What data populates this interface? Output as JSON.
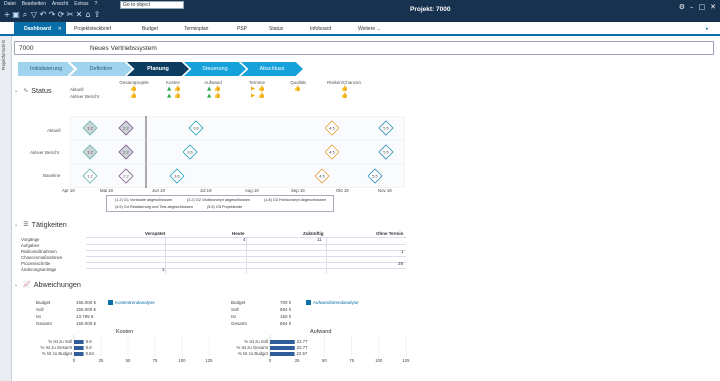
{
  "menu": [
    "Datei",
    "Bearbeiten",
    "Ansicht",
    "Extras",
    "?"
  ],
  "toolbar_icons": [
    "add-icon",
    "save-icon",
    "search-icon",
    "filter-icon",
    "undo-icon",
    "redo-icon",
    "refresh-icon",
    "tools-icon",
    "close-icon",
    "home-icon",
    "export-icon"
  ],
  "goto": "Go to object",
  "project_title": "Projekt: 7000",
  "tabs": {
    "dashboard": "Dashboard",
    "tab_close": "✕",
    "items": [
      "Projektsteckbrief",
      "Budget",
      "Terminplan",
      "PSP",
      "Status",
      "Infoboard",
      "Weitere ..."
    ]
  },
  "side_label": "Projektfortschritt",
  "project": {
    "number": "7000",
    "name": "Neues Vertriebssystem"
  },
  "phases": [
    "Initialisierung",
    "Definition",
    "Planung",
    "Steuerung",
    "Abschluss"
  ],
  "status": {
    "title": "Status",
    "headers": [
      "Gesamtprojekt",
      "Kosten",
      "Aufwand",
      "Termine",
      "Qualität",
      "Risiken/Chancen"
    ],
    "rows": [
      "Aktuell",
      "Aktiver Bericht"
    ]
  },
  "gantt": {
    "rows": [
      "Aktuell",
      "Aktiver Bericht",
      "Baseline"
    ],
    "months": [
      "Apr 19",
      "Mai 19",
      "Jun 19",
      "Jul 19",
      "Aug 19",
      "Sep 19",
      "Okt 19",
      "Nov 19"
    ],
    "milestones": {
      "aktuell": [
        "1.2",
        "2.2",
        "3.6",
        "4.5",
        "5.5"
      ],
      "bericht": [
        "1.2",
        "2.2",
        "3.6",
        "4.5",
        "5.5"
      ],
      "baseline": [
        "1.2",
        "2.2",
        "3.6",
        "4.5",
        "5.5"
      ]
    },
    "legend": [
      "(1.2) G1 Vorstudie abgeschlossen",
      "(2.2) G2 Grobkonzept abgeschlossen",
      "(1.8) G3 Feinkonzept abgeschlossen",
      "(4.5) G4 Realisierung und Test abgeschlossen",
      "(5.5) G5 Projektende"
    ]
  },
  "taetigkeiten": {
    "title": "Tätigkeiten",
    "columns": [
      "Verspätet",
      "Heute",
      "Zukünftig",
      "Ohne Termin"
    ],
    "rows": [
      "Vorgänge",
      "Aufgaben",
      "Risikomaßnahmen",
      "Chancenmaßnahmen",
      "Prozessschritte",
      "Änderungsanträge"
    ],
    "values": {
      "heute_vorgaenge": "4",
      "zukuenftig_vorgaenge": "11",
      "ohne_risiko": "1",
      "ohne_prozess": "29",
      "verspaetet_aenderung": "1"
    }
  },
  "abweichungen": {
    "title": "Abweichungen",
    "kosten": {
      "labels": [
        "Budget",
        "Soll",
        "Ist",
        "Gesamt"
      ],
      "values": [
        "156.000 €",
        "155.000 €",
        "13.795 €",
        "155.000 €"
      ],
      "link": "Kostentrendanalyse"
    },
    "aufwand": {
      "labels": [
        "Budget",
        "Soll",
        "Ist",
        "Gesamt"
      ],
      "values": [
        "700 h",
        "694 h",
        "150 h",
        "694 h"
      ],
      "link": "Aufwandstrendanalyse"
    },
    "kosten_chart": {
      "title": "Kosten",
      "bars": [
        {
          "label": "% Ist zu Soll",
          "value": 8.9,
          "text": "8.9"
        },
        {
          "label": "% Ist zu Gesamt",
          "value": 8.9,
          "text": "8.9"
        },
        {
          "label": "% Ist zu Budget",
          "value": 8.84,
          "text": "8.84"
        }
      ],
      "ticks": [
        "0",
        "25",
        "50",
        "75",
        "100",
        "125"
      ]
    },
    "aufwand_chart": {
      "title": "Aufwand",
      "bars": [
        {
          "label": "% Ist zu Soll",
          "value": 22.77,
          "text": "22.77"
        },
        {
          "label": "% Ist zu Gesamt",
          "value": 22.77,
          "text": "22.77"
        },
        {
          "label": "% Ist zu Budget",
          "value": 22.57,
          "text": "22.57"
        }
      ],
      "ticks": [
        "0",
        "25",
        "50",
        "75",
        "100",
        "125"
      ]
    }
  },
  "colors": {
    "header": "#16324f",
    "accent": "#0a6ea8",
    "phase_done": "#9fd3ee",
    "phase_active": "#0d3c61",
    "phase_next": "#16a1db",
    "green": "#2eaa4f",
    "yellow": "#e8b21b"
  }
}
